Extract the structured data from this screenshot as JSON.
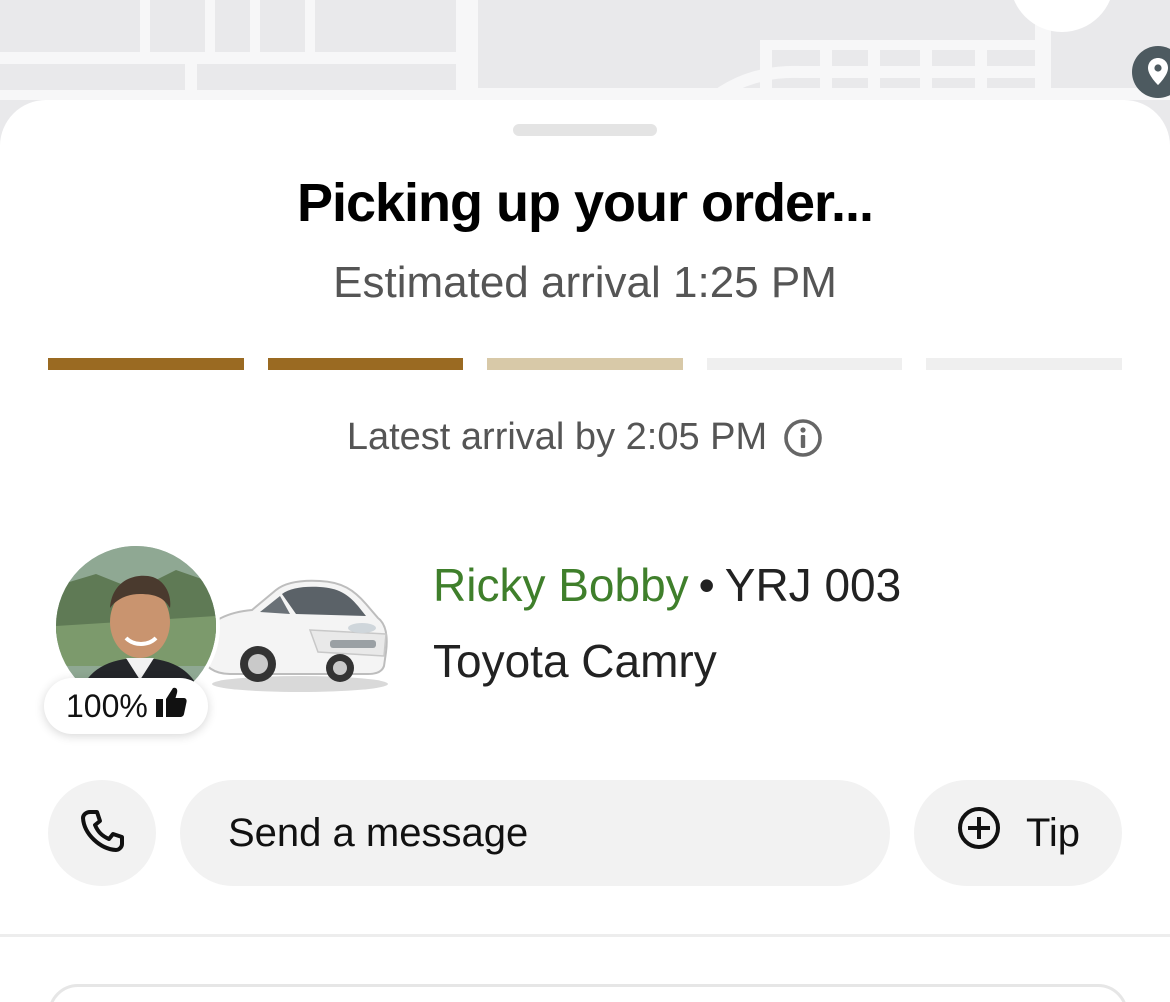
{
  "status": {
    "title": "Picking up your order...",
    "estimated_arrival": "Estimated arrival 1:25 PM",
    "latest_arrival": "Latest arrival by 2:05 PM"
  },
  "progress": {
    "completed_steps": 2,
    "active_step": 3,
    "total_steps": 5,
    "colors": {
      "done": "#9a6a22",
      "active": "#d8c9a8",
      "todo": "#efefef"
    }
  },
  "driver": {
    "name": "Ricky Bobby",
    "separator": "•",
    "plate": "YRJ 003",
    "car_model": "Toyota Camry",
    "rating": "100%",
    "rating_icon": "thumbs-up-icon",
    "name_color": "#3f7f2b"
  },
  "actions": {
    "call_icon": "phone-icon",
    "message_label": "Send a message",
    "tip_icon": "plus-circle-icon",
    "tip_label": "Tip"
  },
  "map": {
    "pin_icon": "location-pin-icon"
  }
}
